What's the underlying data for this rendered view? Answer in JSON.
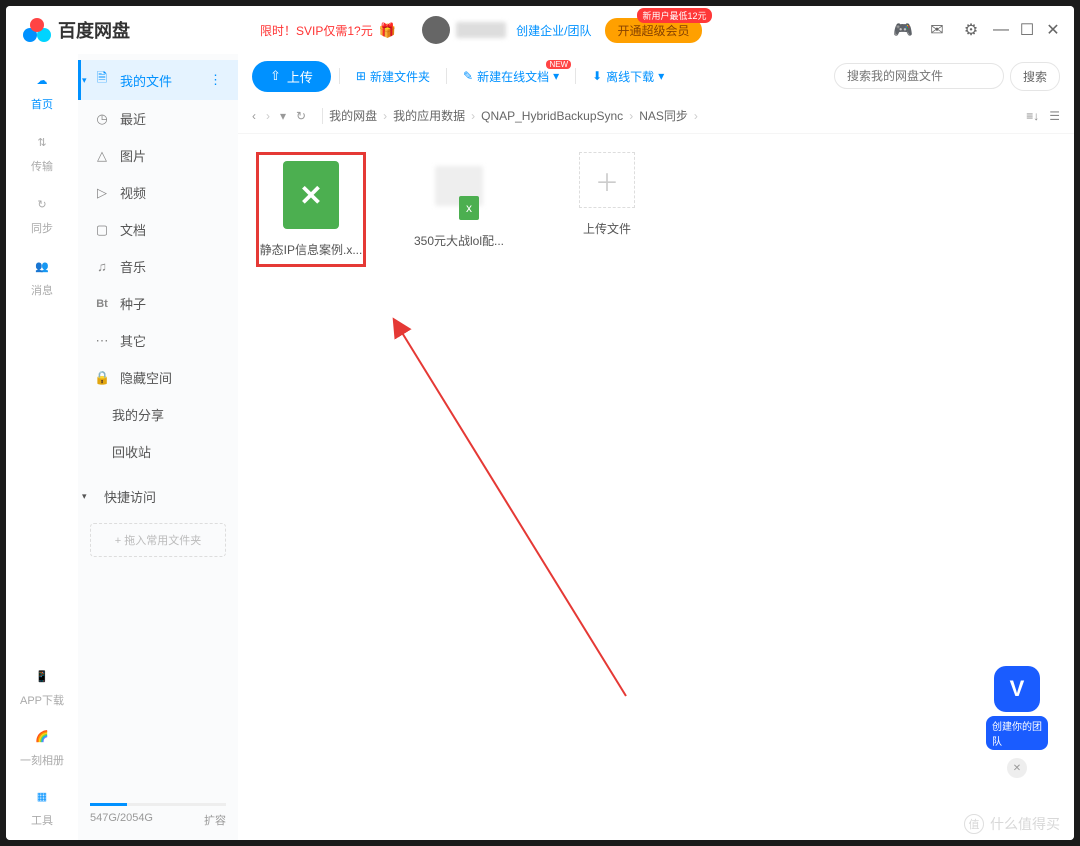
{
  "app_name": "百度网盘",
  "promo": "限时！SVIP仅需1?元",
  "header": {
    "create_team": "创建企业/团队",
    "vip_button": "开通超级会员",
    "vip_badge": "新用户最低12元"
  },
  "navrail": [
    {
      "label": "首页"
    },
    {
      "label": "传输"
    },
    {
      "label": "同步"
    },
    {
      "label": "消息"
    }
  ],
  "navrail_bottom": [
    {
      "label": "APP下载"
    },
    {
      "label": "一刻相册"
    },
    {
      "label": "工具"
    }
  ],
  "sidebar": {
    "items": [
      {
        "label": "我的文件"
      },
      {
        "label": "最近"
      },
      {
        "label": "图片"
      },
      {
        "label": "视频"
      },
      {
        "label": "文档"
      },
      {
        "label": "音乐"
      },
      {
        "label": "种子"
      },
      {
        "label": "其它"
      },
      {
        "label": "隐藏空间"
      }
    ],
    "extra": [
      {
        "label": "我的分享"
      },
      {
        "label": "回收站"
      }
    ],
    "quick": {
      "label": "快捷访问",
      "drop": "+ 拖入常用文件夹"
    },
    "storage": {
      "text": "547G/2054G",
      "expand": "扩容"
    }
  },
  "toolbar": {
    "upload": "上传",
    "new_folder": "新建文件夹",
    "new_doc": "新建在线文档",
    "offline": "离线下载",
    "new_badge": "NEW"
  },
  "search": {
    "placeholder": "搜索我的网盘文件",
    "button": "搜索"
  },
  "breadcrumb": [
    "我的网盘",
    "我的应用数据",
    "QNAP_HybridBackupSync",
    "NAS同步"
  ],
  "files": [
    {
      "name": "静态IP信息案例.x...",
      "type": "xlsx",
      "highlight": true
    },
    {
      "name": "350元大战lol配...",
      "type": "thumb"
    },
    {
      "name": "上传文件",
      "type": "upload"
    }
  ],
  "fab": {
    "label": "创建你的团队"
  },
  "watermark": "什么值得买"
}
